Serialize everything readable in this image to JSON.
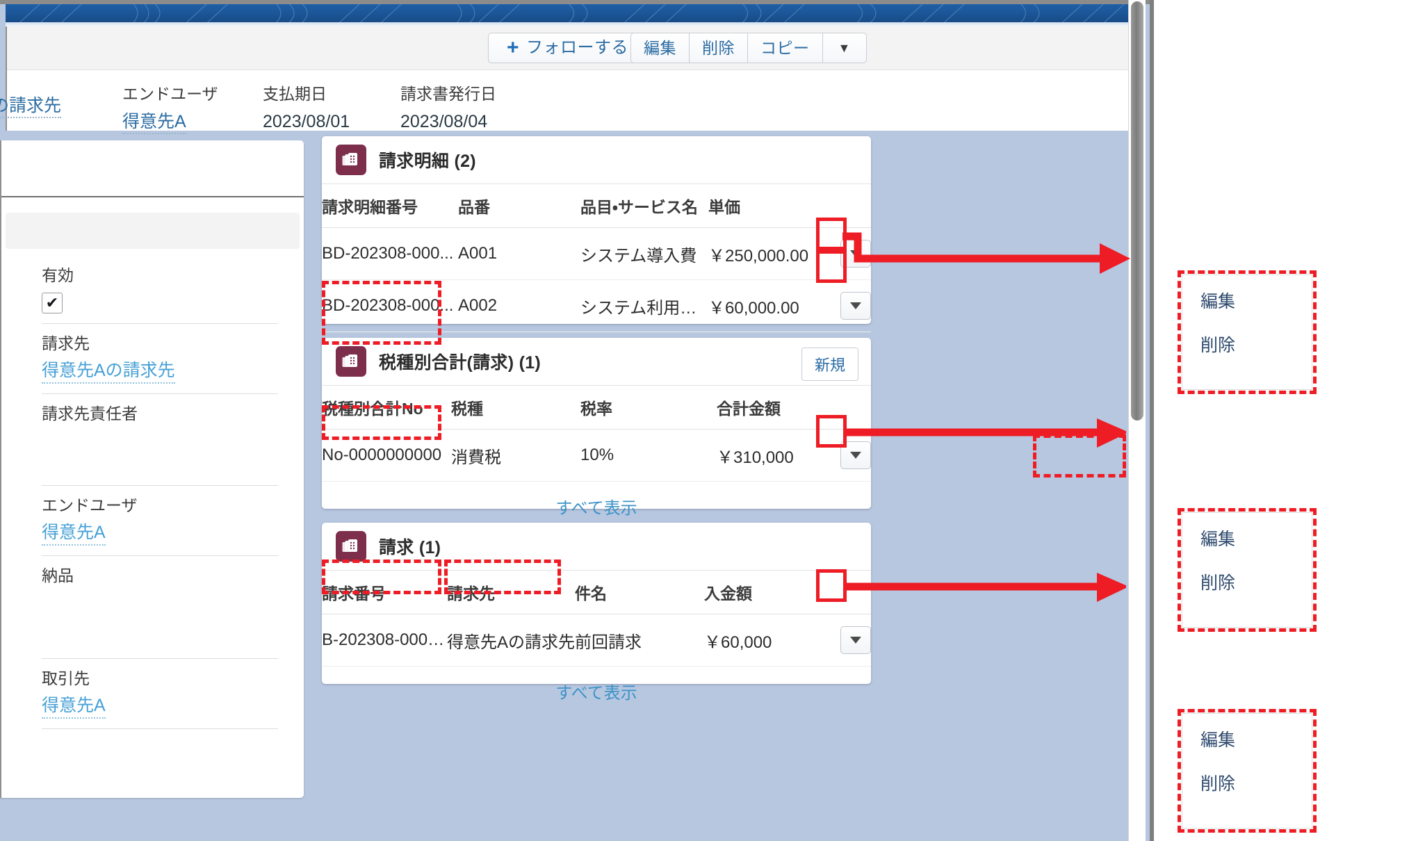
{
  "header": {
    "buttons": {
      "follow": "フォローする",
      "follow_icon": "plus-icon",
      "edit": "編集",
      "delete": "削除",
      "copy": "コピー",
      "more": "▼"
    },
    "fields": [
      {
        "label": "",
        "value": "の請求先",
        "link": true
      },
      {
        "label": "エンドユーザ",
        "value": "得意先A",
        "link": true
      },
      {
        "label": "支払期日",
        "value": "2023/08/01",
        "link": false
      },
      {
        "label": "請求書発行日",
        "value": "2023/08/04",
        "link": false
      }
    ]
  },
  "left_panel": {
    "fields": [
      {
        "label": "有効",
        "value": "✔",
        "type": "checkbox"
      },
      {
        "label": "請求先",
        "value": "得意先Aの請求先",
        "type": "link"
      },
      {
        "label": "請求先責任者",
        "value": "",
        "type": "empty"
      },
      {
        "label": "エンドユーザ",
        "value": "得意先A",
        "type": "link"
      },
      {
        "label": "納品",
        "value": "",
        "type": "empty"
      },
      {
        "label": "取引先",
        "value": "得意先A",
        "type": "link"
      }
    ]
  },
  "related_lists": [
    {
      "icon": "related-list-icon",
      "title": "請求明細 (2)",
      "new_button": null,
      "columns": [
        "請求明細番号",
        "品番",
        "品目・サービス名",
        "単価"
      ],
      "rows": [
        {
          "cells": [
            "BD-202308-000...",
            "A001",
            "システム導入費",
            "￥250,000.00"
          ],
          "link_cols": [
            0
          ]
        },
        {
          "cells": [
            "BD-202308-000...",
            "A002",
            "システム利用月額",
            "￥60,000.00"
          ],
          "link_cols": [
            0
          ]
        }
      ],
      "view_all": "すべて表示"
    },
    {
      "icon": "related-list-icon",
      "title": "税種別合計(請求) (1)",
      "new_button": "新規",
      "columns": [
        "税種別合計No",
        "税種",
        "税率",
        "合計金額"
      ],
      "rows": [
        {
          "cells": [
            "No-0000000000",
            "消費税",
            "10%",
            "￥310,000"
          ],
          "link_cols": [
            0
          ]
        }
      ],
      "view_all": "すべて表示"
    },
    {
      "icon": "related-list-icon",
      "title": "請求 (1)",
      "new_button": null,
      "columns": [
        "請求番号",
        "請求先",
        "件名",
        "入金額"
      ],
      "rows": [
        {
          "cells": [
            "B-202308-0000...",
            "得意先Aの請求先",
            "前回請求",
            "￥60,000"
          ],
          "link_cols": [
            0,
            1
          ]
        }
      ],
      "view_all": "すべて表示"
    }
  ],
  "row_menu": {
    "icon": "chevron-down-icon",
    "label": "▼"
  },
  "callouts": [
    {
      "items": [
        "編集",
        "削除"
      ]
    },
    {
      "items": [
        "編集",
        "削除"
      ]
    },
    {
      "items": [
        "編集",
        "削除"
      ]
    }
  ],
  "colors": {
    "annotation_red": "#ee1c25",
    "link_blue": "#3d93c8",
    "icon_maroon": "#7d2e4a",
    "banner_blue": "#1b5596",
    "page_background": "#b7c7e0"
  }
}
